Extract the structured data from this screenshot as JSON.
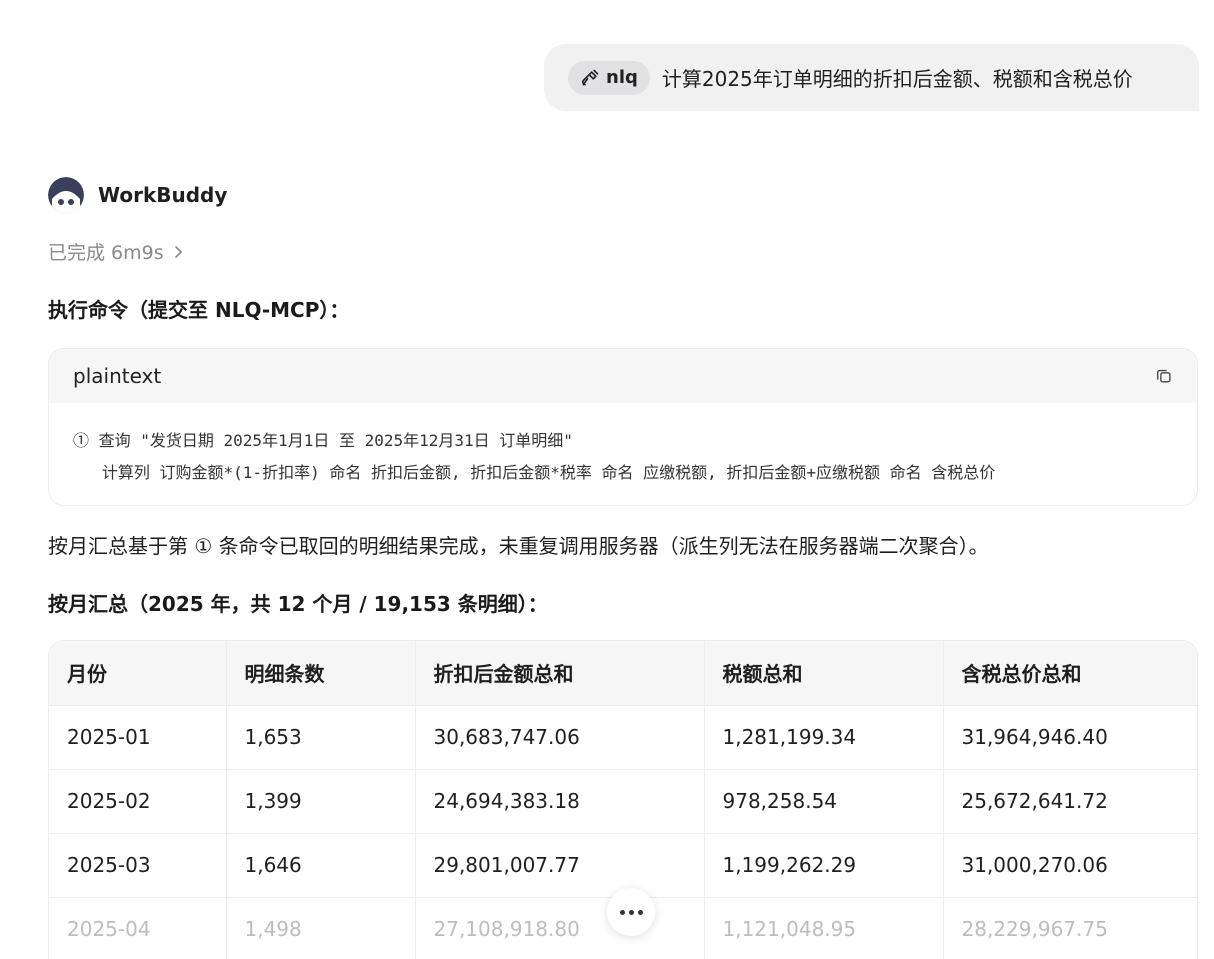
{
  "user_message": {
    "tool_chip_label": "nlq",
    "text": "计算2025年订单明细的折扣后金额、税额和含税总价"
  },
  "assistant": {
    "name": "WorkBuddy",
    "status": "已完成 6m9s"
  },
  "command_heading": "执行命令（提交至 NLQ-MCP）：",
  "code_block": {
    "language": "plaintext",
    "lines": [
      "① 查询 \"发货日期 2025年1月1日 至 2025年12月31日 订单明细\"",
      "   计算列 订购金额*(1-折扣率) 命名 折扣后金额, 折扣后金额*税率 命名 应缴税额, 折扣后金额+应缴税额 命名 含税总价"
    ]
  },
  "paragraph": "按月汇总基于第 ① 条命令已取回的明细结果完成，未重复调用服务器（派生列无法在服务器端二次聚合）。",
  "summary_heading": "按月汇总（2025 年，共 12 个月 / 19,153 条明细）：",
  "table": {
    "headers": [
      "月份",
      "明细条数",
      "折扣后金额总和",
      "税额总和",
      "含税总价总和"
    ],
    "rows": [
      [
        "2025-01",
        "1,653",
        "30,683,747.06",
        "1,281,199.34",
        "31,964,946.40"
      ],
      [
        "2025-02",
        "1,399",
        "24,694,383.18",
        "978,258.54",
        "25,672,641.72"
      ],
      [
        "2025-03",
        "1,646",
        "29,801,007.77",
        "1,199,262.29",
        "31,000,270.06"
      ],
      [
        "2025-04",
        "1,498",
        "27,108,918.80",
        "1,121,048.95",
        "28,229,967.75"
      ]
    ]
  },
  "icons": {
    "tool": "hammer-icon",
    "copy": "copy-icon",
    "chevron": "chevron-right-icon",
    "more": "more-dots-icon"
  }
}
